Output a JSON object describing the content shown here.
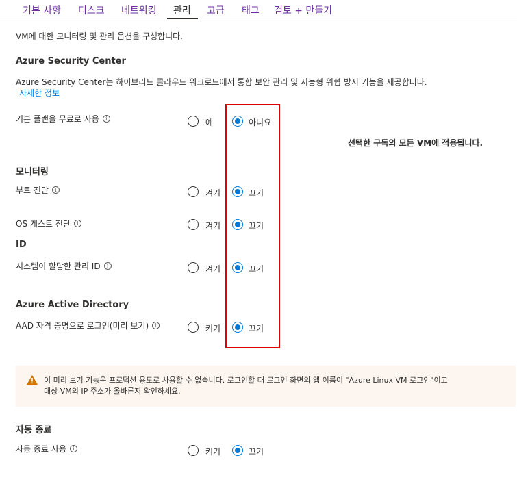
{
  "tabs": [
    "기본 사항",
    "디스크",
    "네트워킹",
    "관리",
    "고급",
    "태그",
    "검토 + 만들기"
  ],
  "intro": "VM에 대한 모니터링 및 관리 옵션을 구성합니다.",
  "security": {
    "heading": "Azure Security Center",
    "description": "Azure Security Center는 하이브리드 클라우드 워크로드에서 통합 보안 관리 및 지능형 위협 방지 기능을 제공합니다.",
    "link": "자세한 정보",
    "free_plan_label": "기본 플랜을 무료로 사용",
    "yes": "예",
    "no": "아니요",
    "selected": "no",
    "note": "선택한 구독의 모든 VM에 적용됩니다."
  },
  "monitoring": {
    "heading": "모니터링",
    "boot_label": "부트 진단",
    "os_label": "OS 게스트 진단",
    "on": "켜기",
    "off": "끄기",
    "boot_selected": "off",
    "os_selected": "off"
  },
  "identity": {
    "heading": "ID",
    "label": "시스템이 할당한 관리 ID",
    "on": "켜기",
    "off": "끄기",
    "selected": "off"
  },
  "aad": {
    "heading": "Azure Active Directory",
    "label": "AAD 자격 증명으로 로그인(미리 보기)",
    "on": "켜기",
    "off": "끄기",
    "selected": "off"
  },
  "banner": {
    "line1": "이 미리 보기 기능은 프로덕션 용도로 사용할 수 없습니다. 로그인할 때 로그인 화면의 앱 이름이 \"Azure Linux VM 로그인\"이고",
    "line2": "대상 VM의 IP 주소가 올바른지 확인하세요.",
    "icon": "warning-icon",
    "icon_color": "#d47500"
  },
  "autoshutdown": {
    "heading": "자동 종료",
    "label": "자동 종료 사용",
    "on": "켜기",
    "off": "끄기",
    "selected": "off"
  },
  "colors": {
    "accent": "#0078d4",
    "tab_link": "#6b2fa0",
    "highlight": "#e00000"
  }
}
